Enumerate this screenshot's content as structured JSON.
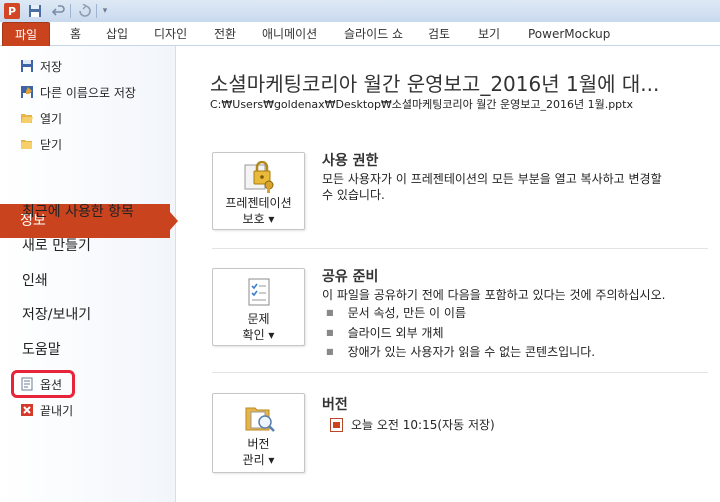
{
  "qat": {
    "app_icon": "P",
    "icons": [
      "save-icon",
      "undo-icon",
      "redo-icon"
    ]
  },
  "tabs": [
    {
      "label": "파일"
    },
    {
      "label": "홈"
    },
    {
      "label": "삽입"
    },
    {
      "label": "디자인"
    },
    {
      "label": "전환"
    },
    {
      "label": "애니메이션"
    },
    {
      "label": "슬라이드 쇼"
    },
    {
      "label": "검토"
    },
    {
      "label": "보기"
    },
    {
      "label": "PowerMockup"
    }
  ],
  "nav": {
    "save": "저장",
    "save_as": "다른 이름으로 저장",
    "open": "열기",
    "close": "닫기",
    "info": "정보",
    "recent": "최근에 사용한 항목",
    "new": "새로 만들기",
    "print": "인쇄",
    "save_send": "저장/보내기",
    "help": "도움말",
    "options": "옵션",
    "exit": "끝내기"
  },
  "doc": {
    "title": "소셜마케팅코리아 월간 운영보고_2016년 1월에 대...",
    "path": "C:₩Users₩goldenax₩Desktop₩소셜마케팅코리아 월간 운영보고_2016년 1월.pptx"
  },
  "permissions": {
    "button_line1": "프레젠테이션",
    "button_line2": "보호 ▾",
    "title": "사용 권한",
    "text_line1": "모든 사용자가 이 프레젠테이션의 모든 부분을 열고 복사하고 변경할",
    "text_line2": "수 있습니다."
  },
  "prepare": {
    "button_line1": "문제",
    "button_line2": "확인 ▾",
    "title": "공유 준비",
    "text": "이 파일을 공유하기 전에 다음을 포함하고 있다는 것에 주의하십시오.",
    "bullets": [
      "문서 속성, 만든 이 이름",
      "슬라이드 외부 개체",
      "장애가 있는 사용자가 읽을 수 없는 콘텐츠입니다."
    ]
  },
  "versions": {
    "button_line1": "버전",
    "button_line2": "관리 ▾",
    "title": "버전",
    "entry": "오늘 오전 10:15(자동 저장)"
  },
  "colors": {
    "file_tab": "#c9431f",
    "highlight": "#e8243a"
  }
}
